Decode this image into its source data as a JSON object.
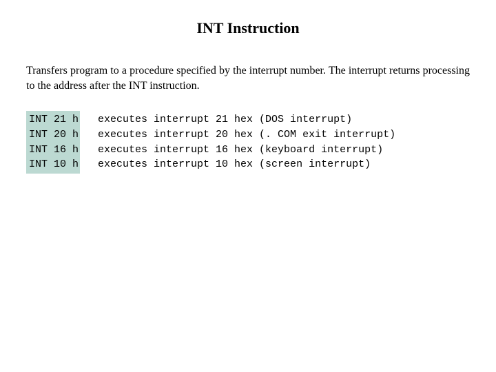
{
  "title": "INT Instruction",
  "description": "Transfers program to a procedure specified by the interrupt number.  The interrupt returns processing to the address after the INT instruction.",
  "listing": {
    "ops_block": "INT 21 h\nINT 20 h\nINT 16 h\nINT 10 h",
    "meanings_block": "executes interrupt 21 hex (DOS interrupt)\nexecutes interrupt 20 hex (. COM exit interrupt)\nexecutes interrupt 16 hex (keyboard interrupt)\nexecutes interrupt 10 hex (screen interrupt)"
  }
}
